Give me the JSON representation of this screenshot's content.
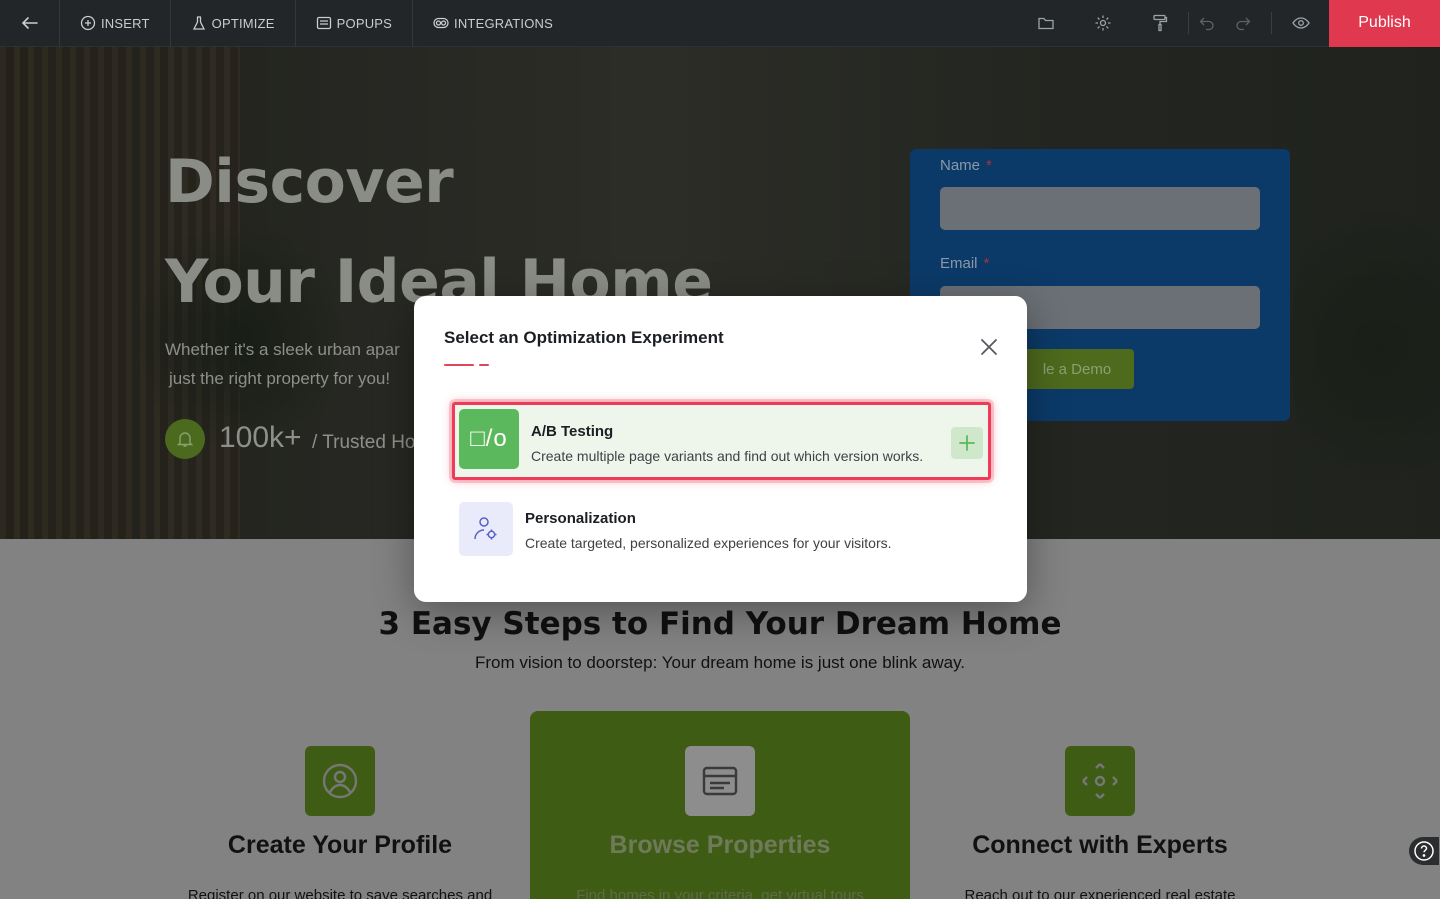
{
  "toolbar": {
    "items": [
      {
        "label": "INSERT",
        "icon": "plus-circle-icon"
      },
      {
        "label": "OPTIMIZE",
        "icon": "flask-icon"
      },
      {
        "label": "POPUPS",
        "icon": "popup-window-icon"
      },
      {
        "label": "INTEGRATIONS",
        "icon": "toggle-link-icon"
      }
    ],
    "right_icons": [
      "folder-icon",
      "gear-icon",
      "paint-roller-icon",
      "undo-icon",
      "redo-icon",
      "eye-icon"
    ],
    "publish_label": "Publish"
  },
  "hero": {
    "title_line1": "Discover",
    "title_line2": "Your Ideal Home",
    "subtitle_line1": "Whether it's a sleek urban apar",
    "subtitle_line2": "just the right property for you!",
    "stat_value": "100k+",
    "stat_label": "/ Trusted Ho"
  },
  "form": {
    "name_label": "Name",
    "email_label": "Email",
    "required_mark": "*",
    "submit_label": "le a Demo"
  },
  "steps": {
    "title": "3 Easy Steps to Find Your Dream Home",
    "subtitle": "From vision to doorstep: Your dream home is just one blink away.",
    "cards": [
      {
        "title": "Create Your Profile",
        "desc": "Register on our website to save searches and",
        "icon": "user-circle-icon"
      },
      {
        "title": "Browse Properties",
        "desc": "Find homes in your criteria, get virtual tours",
        "icon": "browser-window-icon"
      },
      {
        "title": "Connect with Experts",
        "desc": "Reach out to our experienced real estate",
        "icon": "move-arrows-icon"
      }
    ]
  },
  "modal": {
    "title": "Select an Optimization Experiment",
    "options": [
      {
        "title": "A/B Testing",
        "desc": "Create multiple page variants and find out which version works.",
        "icon": "ab-split-icon",
        "icon_text": "□/o",
        "selected": true
      },
      {
        "title": "Personalization",
        "desc": "Create targeted, personalized experiences for your visitors.",
        "icon": "user-gear-icon",
        "selected": false
      }
    ]
  },
  "colors": {
    "accent": "#e0384f",
    "brand_green": "#5cb85c",
    "highlight_border": "#ef3b57"
  }
}
